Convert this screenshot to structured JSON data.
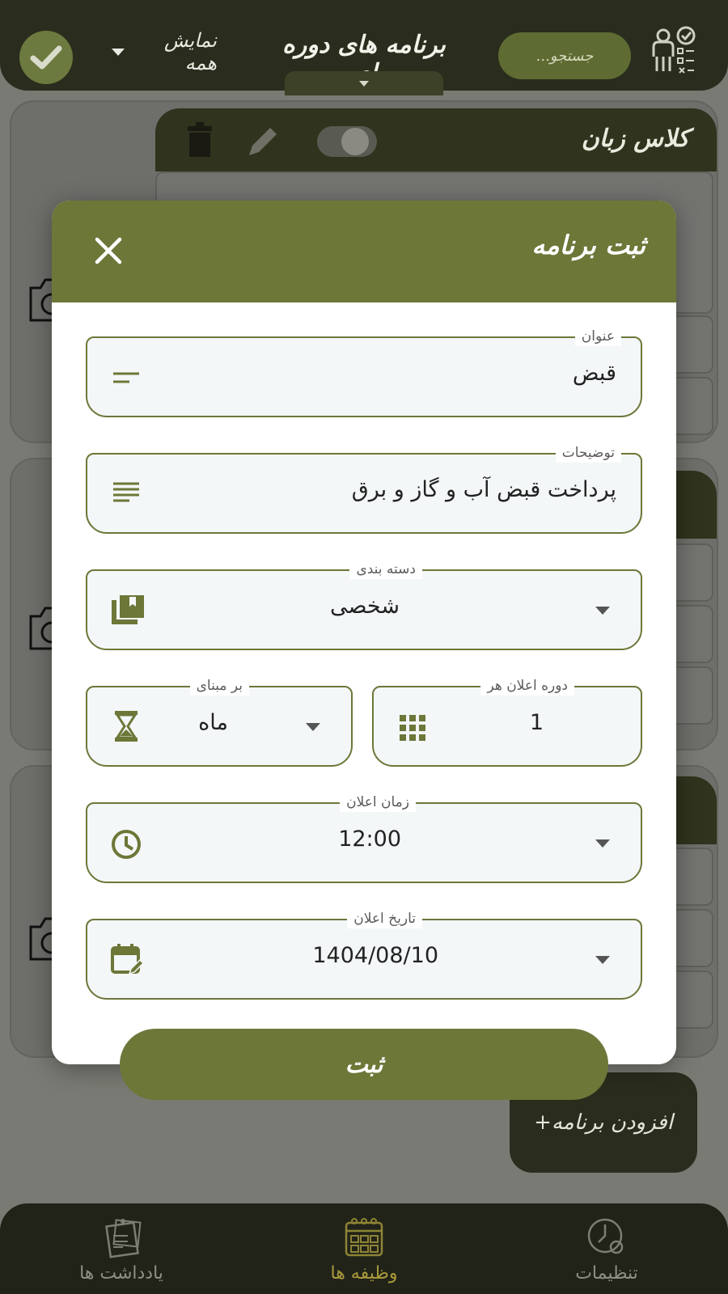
{
  "header": {
    "title": "برنامه های دوره ای",
    "filter_label": "نمایش همه",
    "search_placeholder": "جستجو..."
  },
  "background_card": {
    "title": "کلاس زبان"
  },
  "fab": {
    "label": "افزودن برنامه+"
  },
  "modal": {
    "title": "ثبت برنامه",
    "fields": {
      "title": {
        "label": "عنوان",
        "value": "قبض"
      },
      "description": {
        "label": "توضیحات",
        "value": "پرداخت قبض آب و گاز و برق"
      },
      "category": {
        "label": "دسته بندی",
        "value": "شخصی"
      },
      "interval": {
        "label": "دوره اعلان هر",
        "value": "1"
      },
      "basis": {
        "label": "بر مبنای",
        "value": "ماه"
      },
      "time": {
        "label": "زمان اعلان",
        "value": "12:00"
      },
      "date": {
        "label": "تاریخ اعلان",
        "value": "1404/08/10"
      }
    },
    "submit_label": "ثبت"
  },
  "bottom_nav": {
    "items": [
      {
        "label": "تنظیمات",
        "icon": "settings-clock-icon",
        "active": false
      },
      {
        "label": "وظیفه ها",
        "icon": "calendar-grid-icon",
        "active": true
      },
      {
        "label": "یادداشت ها",
        "icon": "notes-icon",
        "active": false
      }
    ]
  },
  "colors": {
    "accent": "#6c7738",
    "dark": "#2a2c1d",
    "field_bg": "#f3f7f8",
    "active_nav": "#a89a3c"
  }
}
